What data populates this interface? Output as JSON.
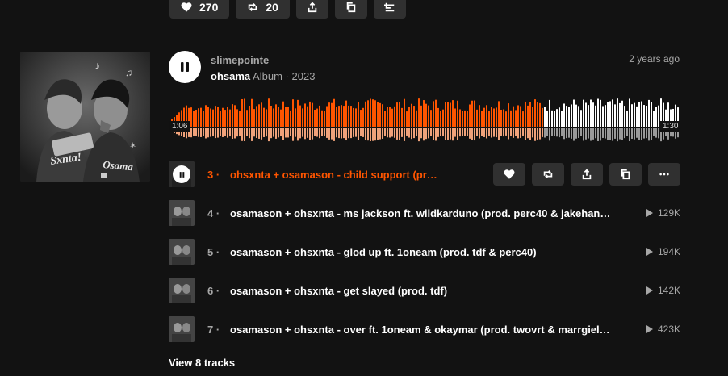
{
  "stats": {
    "likes": "270",
    "reposts": "20"
  },
  "playlist": {
    "artist": "slimepointe",
    "title": "ohsama",
    "type": "Album",
    "year": "2023",
    "posted": "2 years ago",
    "cover_text_left": "Sxnta!",
    "cover_text_right": "Osama"
  },
  "player": {
    "elapsed": "1:06",
    "duration": "1:30",
    "progress": 0.73,
    "played_color": "#ff5500",
    "unplayed_color": "#ffffff"
  },
  "tracks": [
    {
      "num": "3",
      "title": "ohsxnta + osamason - child support (prod. …)",
      "plays": ""
    },
    {
      "num": "4",
      "title": "osamason + ohsxnta - ms jackson ft. wildkarduno (prod. perc40 & jakehan…",
      "plays": "129K"
    },
    {
      "num": "5",
      "title": "osamason + ohsxnta - glod up ft. 1oneam (prod. tdf & perc40)",
      "plays": "194K"
    },
    {
      "num": "6",
      "title": "osamason + ohsxnta - get slayed (prod. tdf)",
      "plays": "142K"
    },
    {
      "num": "7",
      "title": "osamason + ohsxnta - over ft. 1oneam & okaymar (prod. twovrt & marrgiel…",
      "plays": "423K"
    }
  ],
  "view_all": "View 8 tracks",
  "accent": "#ff5500",
  "icons": [
    "heart-icon",
    "repost-icon",
    "share-icon",
    "copy-icon",
    "add-to-next-icon",
    "pause-icon",
    "more-icon",
    "play-count-icon"
  ]
}
